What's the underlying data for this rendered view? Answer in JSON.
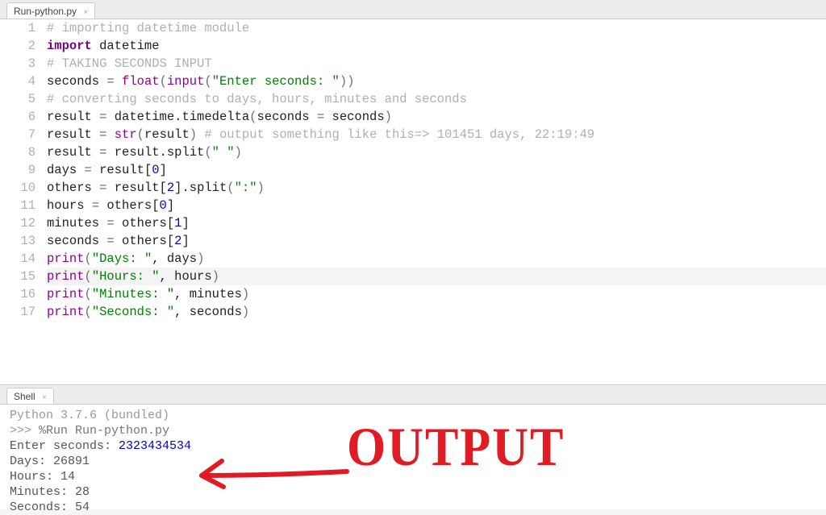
{
  "editor_tab": {
    "label": "Run-python.py"
  },
  "shell_tab": {
    "label": "Shell"
  },
  "code_lines": [
    {
      "n": 1,
      "segs": [
        {
          "c": "c-comment",
          "t": "# importing datetime module"
        }
      ]
    },
    {
      "n": 2,
      "segs": [
        {
          "c": "c-keyword",
          "t": "import"
        },
        {
          "c": "c-default",
          "t": " datetime"
        }
      ]
    },
    {
      "n": 3,
      "segs": [
        {
          "c": "c-comment",
          "t": "# TAKING SECONDS INPUT"
        }
      ]
    },
    {
      "n": 4,
      "segs": [
        {
          "c": "c-default",
          "t": "seconds "
        },
        {
          "c": "c-op",
          "t": "="
        },
        {
          "c": "c-default",
          "t": " "
        },
        {
          "c": "c-builtin",
          "t": "float"
        },
        {
          "c": "c-paren",
          "t": "("
        },
        {
          "c": "c-builtin",
          "t": "input"
        },
        {
          "c": "c-paren",
          "t": "("
        },
        {
          "c": "c-string",
          "t": "\"Enter seconds: \""
        },
        {
          "c": "c-paren",
          "t": "))"
        }
      ]
    },
    {
      "n": 5,
      "segs": [
        {
          "c": "c-comment",
          "t": "# converting seconds to days, hours, minutes and seconds"
        }
      ]
    },
    {
      "n": 6,
      "segs": [
        {
          "c": "c-default",
          "t": "result "
        },
        {
          "c": "c-op",
          "t": "="
        },
        {
          "c": "c-default",
          "t": " datetime.timedelta"
        },
        {
          "c": "c-paren",
          "t": "("
        },
        {
          "c": "c-default",
          "t": "seconds "
        },
        {
          "c": "c-op",
          "t": "="
        },
        {
          "c": "c-default",
          "t": " seconds"
        },
        {
          "c": "c-paren",
          "t": ")"
        }
      ]
    },
    {
      "n": 7,
      "segs": [
        {
          "c": "c-default",
          "t": "result "
        },
        {
          "c": "c-op",
          "t": "="
        },
        {
          "c": "c-default",
          "t": " "
        },
        {
          "c": "c-builtin",
          "t": "str"
        },
        {
          "c": "c-paren",
          "t": "("
        },
        {
          "c": "c-default",
          "t": "result"
        },
        {
          "c": "c-paren",
          "t": ")"
        },
        {
          "c": "c-default",
          "t": " "
        },
        {
          "c": "c-comment",
          "t": "# output something like this=> 101451 days, 22:19:49"
        }
      ]
    },
    {
      "n": 8,
      "segs": [
        {
          "c": "c-default",
          "t": "result "
        },
        {
          "c": "c-op",
          "t": "="
        },
        {
          "c": "c-default",
          "t": " result.split"
        },
        {
          "c": "c-paren",
          "t": "("
        },
        {
          "c": "c-string",
          "t": "\" \""
        },
        {
          "c": "c-paren",
          "t": ")"
        }
      ]
    },
    {
      "n": 9,
      "segs": [
        {
          "c": "c-default",
          "t": "days "
        },
        {
          "c": "c-op",
          "t": "="
        },
        {
          "c": "c-default",
          "t": " result["
        },
        {
          "c": "c-number",
          "t": "0"
        },
        {
          "c": "c-default",
          "t": "]"
        }
      ]
    },
    {
      "n": 10,
      "segs": [
        {
          "c": "c-default",
          "t": "others "
        },
        {
          "c": "c-op",
          "t": "="
        },
        {
          "c": "c-default",
          "t": " result["
        },
        {
          "c": "c-number",
          "t": "2"
        },
        {
          "c": "c-default",
          "t": "].split"
        },
        {
          "c": "c-paren",
          "t": "("
        },
        {
          "c": "c-string",
          "t": "\":\""
        },
        {
          "c": "c-paren",
          "t": ")"
        }
      ]
    },
    {
      "n": 11,
      "segs": [
        {
          "c": "c-default",
          "t": "hours "
        },
        {
          "c": "c-op",
          "t": "="
        },
        {
          "c": "c-default",
          "t": " others["
        },
        {
          "c": "c-number",
          "t": "0"
        },
        {
          "c": "c-default",
          "t": "]"
        }
      ]
    },
    {
      "n": 12,
      "segs": [
        {
          "c": "c-default",
          "t": "minutes "
        },
        {
          "c": "c-op",
          "t": "="
        },
        {
          "c": "c-default",
          "t": " others["
        },
        {
          "c": "c-number",
          "t": "1"
        },
        {
          "c": "c-default",
          "t": "]"
        }
      ]
    },
    {
      "n": 13,
      "segs": [
        {
          "c": "c-default",
          "t": "seconds "
        },
        {
          "c": "c-op",
          "t": "="
        },
        {
          "c": "c-default",
          "t": " others["
        },
        {
          "c": "c-number",
          "t": "2"
        },
        {
          "c": "c-default",
          "t": "]"
        }
      ]
    },
    {
      "n": 14,
      "segs": [
        {
          "c": "c-builtin",
          "t": "print"
        },
        {
          "c": "c-paren",
          "t": "("
        },
        {
          "c": "c-string",
          "t": "\"Days: \""
        },
        {
          "c": "c-default",
          "t": ", days"
        },
        {
          "c": "c-paren",
          "t": ")"
        }
      ]
    },
    {
      "n": 15,
      "hl": true,
      "segs": [
        {
          "c": "c-builtin",
          "t": "print"
        },
        {
          "c": "c-paren",
          "t": "("
        },
        {
          "c": "c-string",
          "t": "\"Hours: \""
        },
        {
          "c": "c-default",
          "t": ", hours"
        },
        {
          "c": "c-paren",
          "t": ")"
        }
      ]
    },
    {
      "n": 16,
      "segs": [
        {
          "c": "c-builtin",
          "t": "print"
        },
        {
          "c": "c-paren",
          "t": "("
        },
        {
          "c": "c-string",
          "t": "\"Minutes: \""
        },
        {
          "c": "c-default",
          "t": ", minutes"
        },
        {
          "c": "c-paren",
          "t": ")"
        }
      ]
    },
    {
      "n": 17,
      "segs": [
        {
          "c": "c-builtin",
          "t": "print"
        },
        {
          "c": "c-paren",
          "t": "("
        },
        {
          "c": "c-string",
          "t": "\"Seconds: \""
        },
        {
          "c": "c-default",
          "t": ", seconds"
        },
        {
          "c": "c-paren",
          "t": ")"
        }
      ]
    }
  ],
  "shell": {
    "version": "Python 3.7.6 (bundled)",
    "prompt": ">>> ",
    "run_cmd": "%Run Run-python.py",
    "lines": [
      {
        "label": " Enter seconds: ",
        "value": "2323434534",
        "value_class": "input-val"
      },
      {
        "label": " Days:  ",
        "value": "26891"
      },
      {
        "label": " Hours:  ",
        "value": "14"
      },
      {
        "label": " Minutes:  ",
        "value": "28"
      },
      {
        "label": " Seconds:  ",
        "value": "54"
      }
    ]
  },
  "annotation": {
    "text": "OUTPUT"
  }
}
